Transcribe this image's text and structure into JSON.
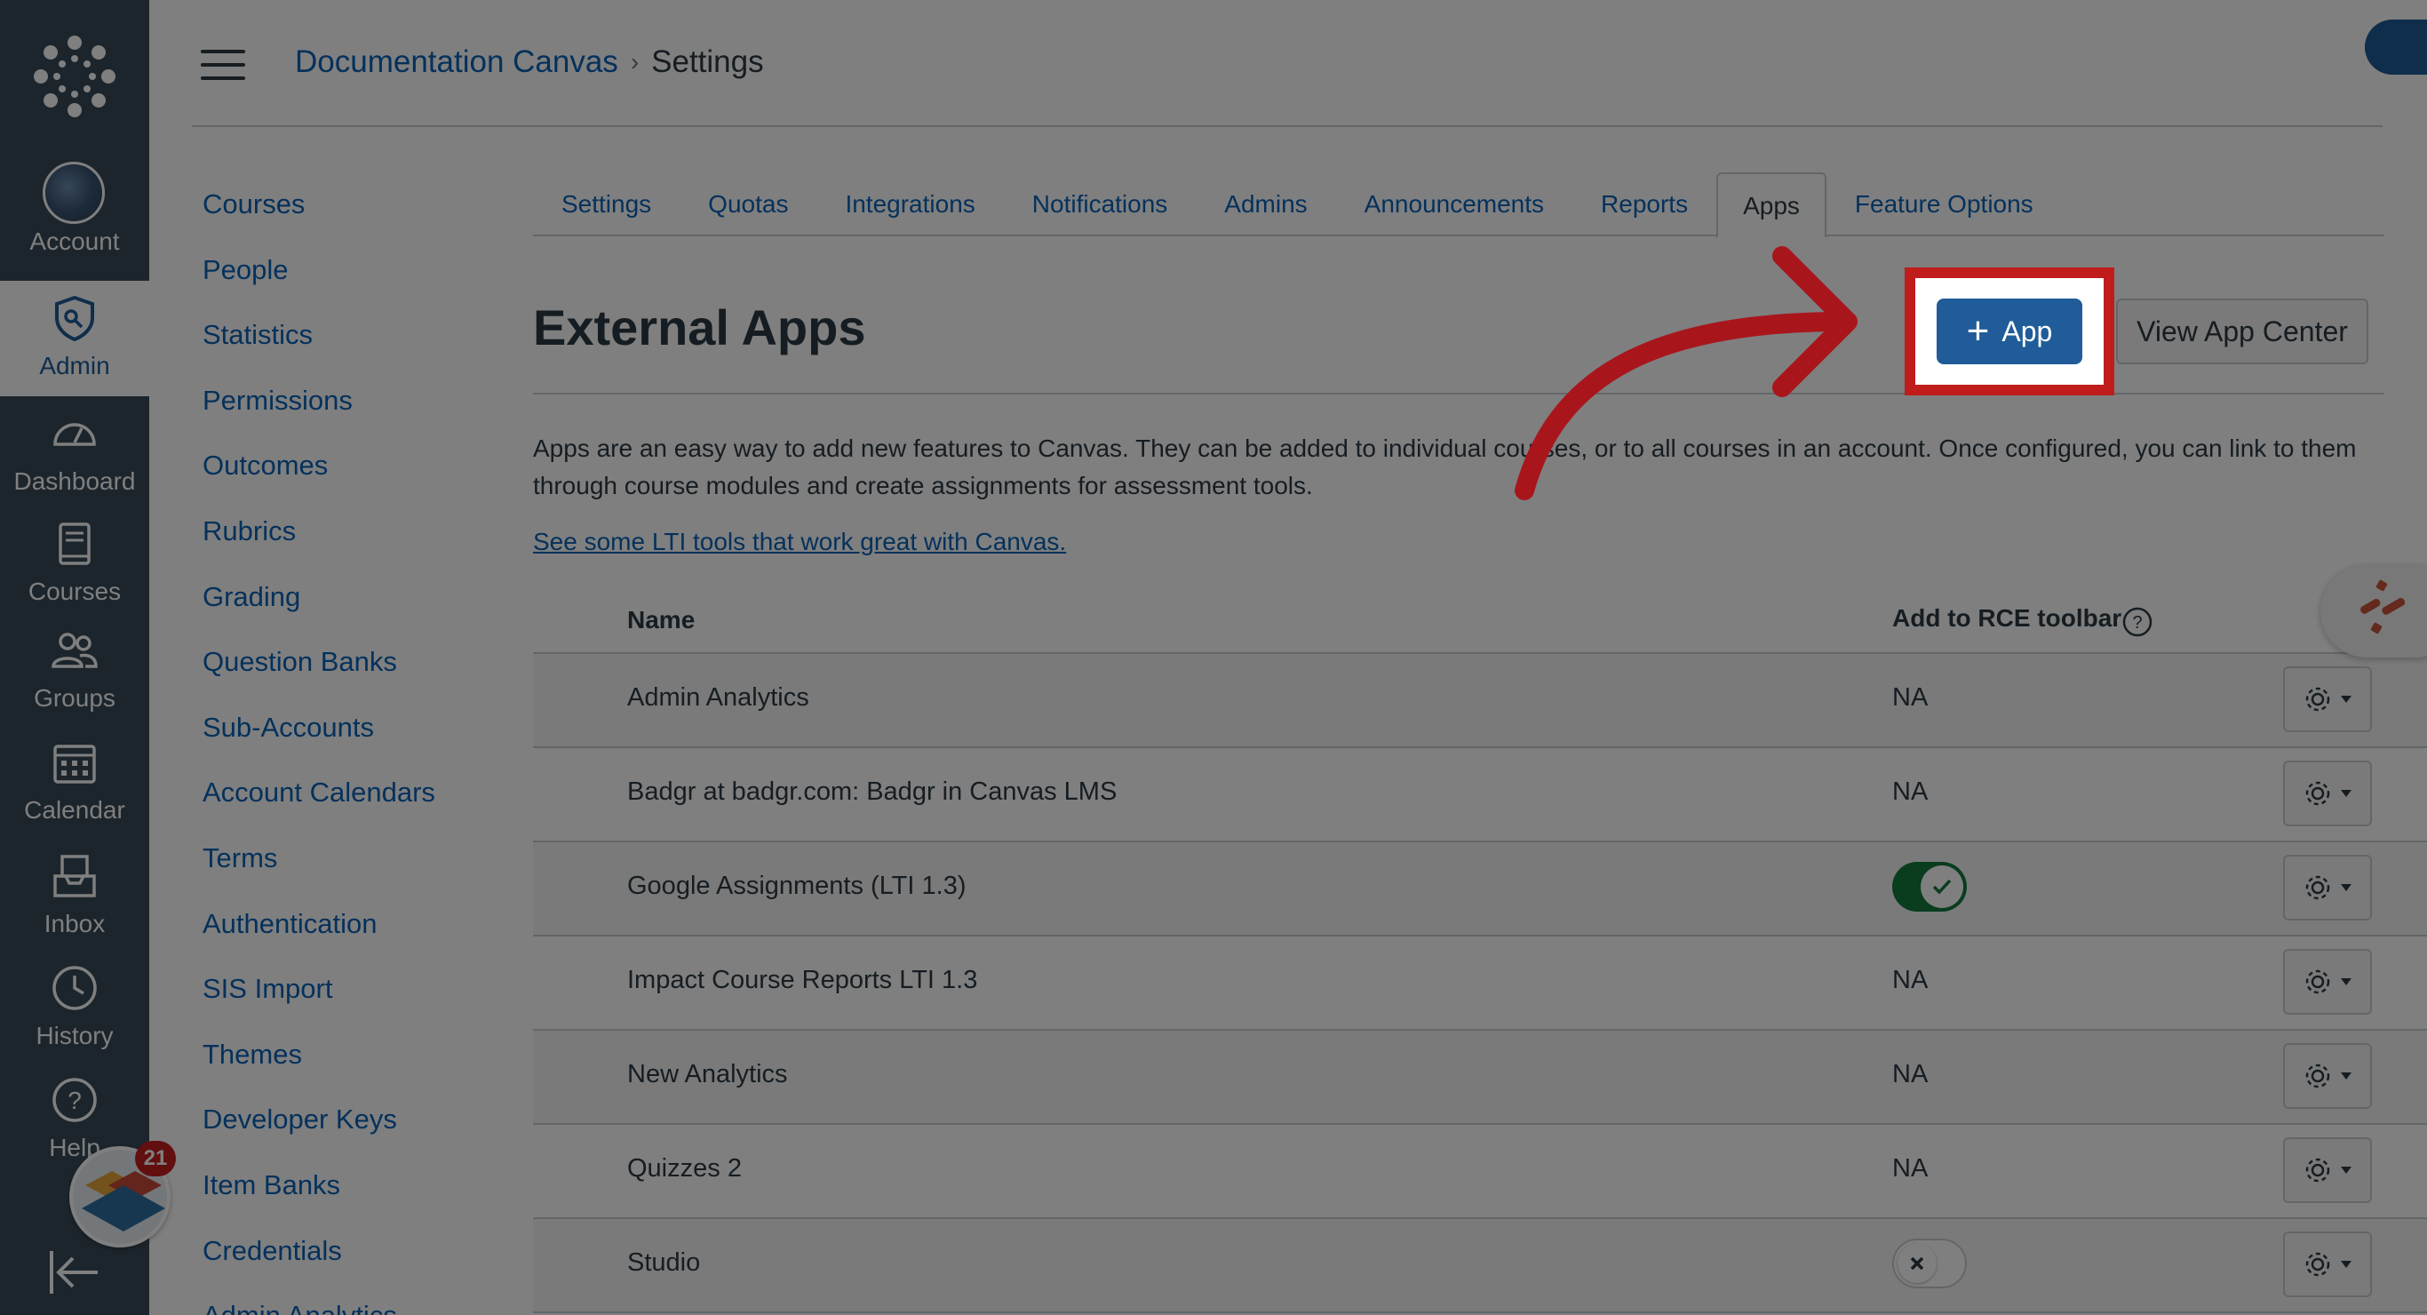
{
  "global_nav": {
    "items": [
      {
        "label": "Account",
        "icon": "avatar"
      },
      {
        "label": "Admin",
        "icon": "shield-icon"
      },
      {
        "label": "Dashboard",
        "icon": "speedometer-icon"
      },
      {
        "label": "Courses",
        "icon": "book-icon"
      },
      {
        "label": "Groups",
        "icon": "users-icon"
      },
      {
        "label": "Calendar",
        "icon": "calendar-icon"
      },
      {
        "label": "Inbox",
        "icon": "inbox-icon"
      },
      {
        "label": "History",
        "icon": "clock-icon"
      },
      {
        "label": "Help",
        "icon": "question-icon"
      }
    ],
    "notification_count": "21"
  },
  "header": {
    "breadcrumb_root": "Documentation Canvas",
    "breadcrumb_sep": "›",
    "breadcrumb_current": "Settings"
  },
  "subnav": {
    "items": [
      "Courses",
      "People",
      "Statistics",
      "Permissions",
      "Outcomes",
      "Rubrics",
      "Grading",
      "Question Banks",
      "Sub-Accounts",
      "Account Calendars",
      "Terms",
      "Authentication",
      "SIS Import",
      "Themes",
      "Developer Keys",
      "Item Banks",
      "Credentials",
      "Admin Analytics"
    ]
  },
  "tabs": [
    "Settings",
    "Quotas",
    "Integrations",
    "Notifications",
    "Admins",
    "Announcements",
    "Reports",
    "Apps",
    "Feature Options"
  ],
  "main": {
    "title": "External Apps",
    "add_app_label": "App",
    "view_app_center_label": "View App Center",
    "description": "Apps are an easy way to add new features to Canvas. They can be added to individual courses, or to all courses in an account. Once configured, you can link to them through course modules and create assignments for assessment tools.",
    "lti_link": "See some LTI tools that work great with Canvas."
  },
  "table": {
    "col_name": "Name",
    "col_rce": "Add to RCE toolbar",
    "rows": [
      {
        "name": "Admin Analytics",
        "rce": "NA"
      },
      {
        "name": "Badgr at badgr.com: Badgr in Canvas LMS",
        "rce": "NA"
      },
      {
        "name": "Google Assignments (LTI 1.3)",
        "rce": "toggle-on"
      },
      {
        "name": "Impact Course Reports LTI 1.3",
        "rce": "NA"
      },
      {
        "name": "New Analytics",
        "rce": "NA"
      },
      {
        "name": "Quizzes 2",
        "rce": "NA"
      },
      {
        "name": "Studio",
        "rce": "toggle-off"
      }
    ]
  },
  "colors": {
    "nav_bg": "#394b58",
    "brand_blue": "#1f5c99",
    "link": "#0b63b6",
    "highlight_red": "#c01c1c",
    "toggle_green": "#127a3d"
  }
}
